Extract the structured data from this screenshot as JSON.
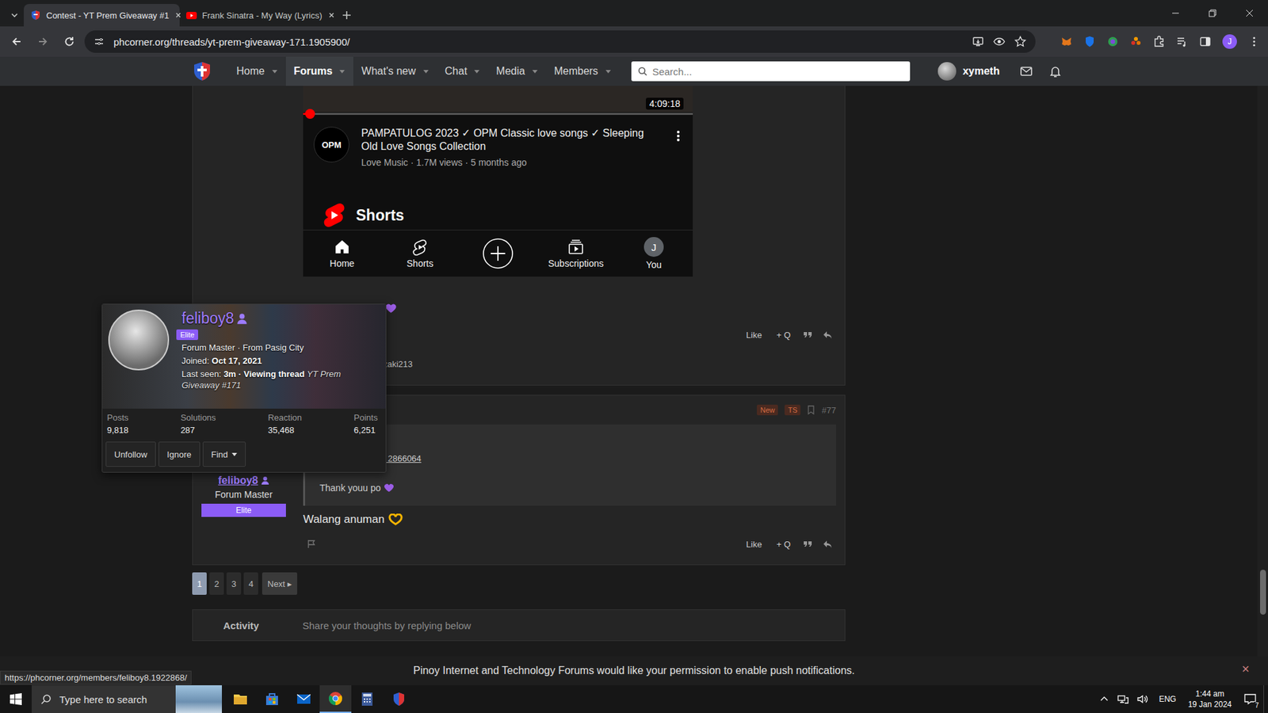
{
  "browser": {
    "tabs": [
      {
        "label": "Contest - YT Prem Giveaway #1",
        "selected": true,
        "kind": "forum"
      },
      {
        "label": "Frank Sinatra - My Way (Lyrics)",
        "selected": false,
        "kind": "youtube"
      }
    ],
    "url": "phcorner.org/threads/yt-prem-giveaway-171.1905900/",
    "profile": "J"
  },
  "forum_nav": {
    "items": [
      {
        "label": "Home",
        "selected": false
      },
      {
        "label": "Forums",
        "selected": true
      },
      {
        "label": "What's new",
        "selected": false
      },
      {
        "label": "Chat",
        "selected": false
      },
      {
        "label": "Media",
        "selected": false
      },
      {
        "label": "Members",
        "selected": false
      }
    ],
    "search_placeholder": "Search...",
    "username": "xymeth"
  },
  "top_post": {
    "attachment": {
      "duration": "4:09:18",
      "progress": {
        "level": 0.015
      },
      "video": {
        "avatar": "OPM",
        "title": "PAMPATULOG 2023 ✓ OPM Classic love songs ✓ Sleeping Old Love Songs Collection",
        "meta": "Love Music · 1.7M views · 5 months ago"
      },
      "shelf": "Shorts",
      "bottom_nav": [
        {
          "kind": "home",
          "label": "Home",
          "selected": true
        },
        {
          "kind": "shorts",
          "label": "Shorts",
          "selected": false
        },
        {
          "kind": "create",
          "selected": false
        },
        {
          "kind": "subscriptions",
          "label": "Subscriptions",
          "selected": false
        },
        {
          "kind": "avatar",
          "avatar": "J",
          "label": "You",
          "selected": false
        }
      ]
    },
    "actions": [
      "Like",
      "+ Q"
    ],
    "reactions": "zaki213"
  },
  "hover_card": {
    "name": "feliboy8",
    "badge": "Elite",
    "title_line": "Forum Master · From Pasig City",
    "joined_label": "Joined:",
    "joined": "Oct 17, 2021",
    "last_seen_label": "Last seen:",
    "last_seen": "3m · Viewing thread",
    "thread": "YT Prem Giveaway #171",
    "stats": [
      {
        "label": "Posts",
        "value": "9,818"
      },
      {
        "label": "Solutions",
        "value": "287"
      },
      {
        "label": "Reaction",
        "value": "35,468"
      },
      {
        "label": "Points",
        "value": "6,251"
      }
    ],
    "buttons": [
      "Unfollow",
      "Ignore",
      "Find"
    ]
  },
  "post": {
    "badges": [
      "New",
      "TS"
    ],
    "number": "#77",
    "author": "feliboy8",
    "role": "Forum Master",
    "banner": "Elite",
    "quote_link": "t 2866064",
    "quote_text": "Thank youu po",
    "text": "Walang anuman",
    "actions": [
      "Like",
      "+ Q"
    ]
  },
  "pagination": {
    "pages": [
      {
        "label": "1",
        "selected": true
      },
      {
        "label": "2",
        "selected": false
      },
      {
        "label": "3",
        "selected": false
      },
      {
        "label": "4",
        "selected": false
      }
    ],
    "next": "Next ▸"
  },
  "activity": {
    "label": "Activity",
    "placeholder": "Share your thoughts by replying below"
  },
  "push_bar": {
    "text": "Pinoy Internet and Technology Forums would like your permission to enable push notifications.",
    "close": "×"
  },
  "status_url": "https://phcorner.org/members/feliboy8.1922868/",
  "taskbar": {
    "search_placeholder": "Type here to search",
    "language": "ENG",
    "time": "1:44 am",
    "date": "19 Jan 2024",
    "notifications": "7"
  }
}
